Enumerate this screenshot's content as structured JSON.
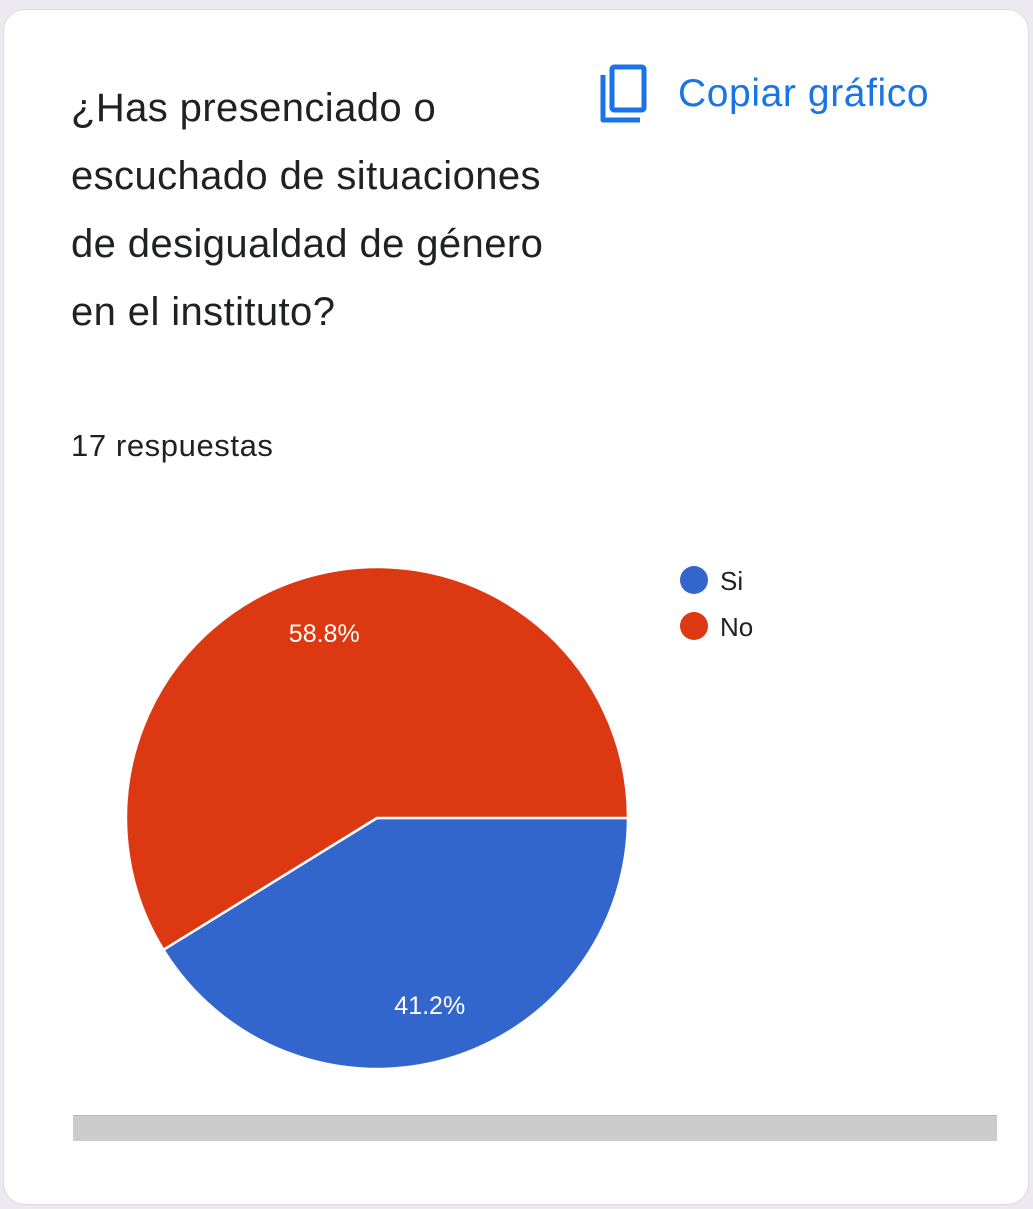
{
  "card": {
    "question": "¿Has presenciado o escuchado de situaciones de desigualdad de género en el instituto?",
    "responses": "17 respuestas",
    "copy_label": "Copiar gráfico",
    "copy_icon": "copy-icon"
  },
  "colors": {
    "accent": "#1a73e8",
    "si": "#3366cc",
    "no": "#dc3912",
    "scrollbar": "#cccccc"
  },
  "chart_data": {
    "type": "pie",
    "categories": [
      "Si",
      "No"
    ],
    "values": [
      41.2,
      58.8
    ],
    "labels": [
      "41.2%",
      "58.8%"
    ],
    "colors": [
      "#3366cc",
      "#dc3912"
    ],
    "legend_position": "right"
  }
}
